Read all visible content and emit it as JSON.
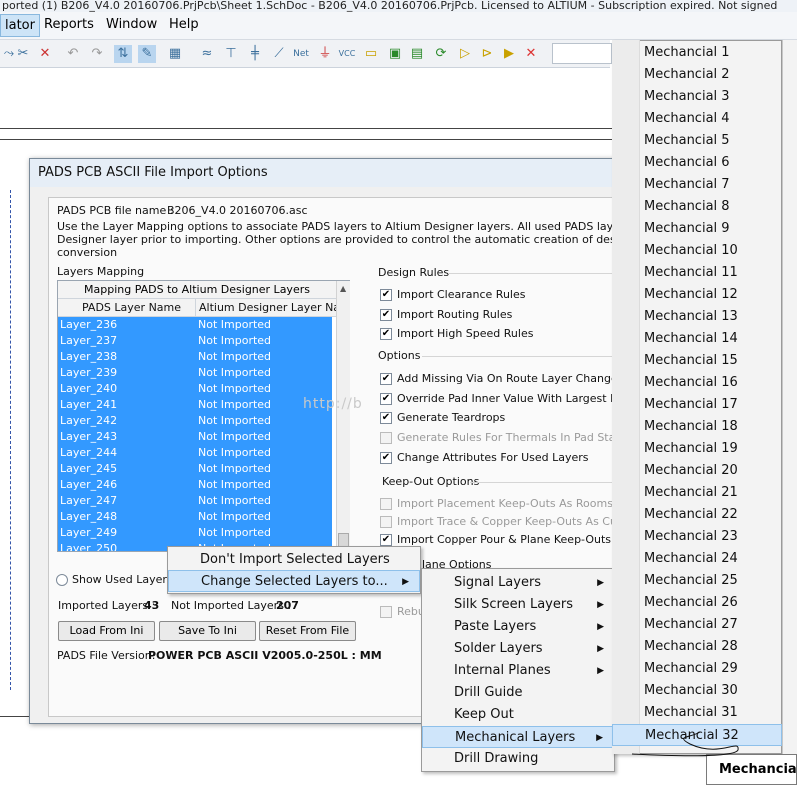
{
  "app": {
    "title": "ported (1) B206_V4.0 20160706.PrjPcb\\Sheet 1.SchDoc - B206_V4.0 20160706.PrjPcb. Licensed to ALTIUM - Subscription expired. Not signed"
  },
  "menubar": {
    "items": [
      "lator",
      "Reports",
      "Window",
      "Help"
    ]
  },
  "dialog": {
    "title": "PADS PCB ASCII File Import Options",
    "file_label": "PADS PCB file name :",
    "file_name": "B206_V4.0 20160706.asc",
    "desc1": "Use the Layer Mapping options to associate PADS layers to Altium Designer layers. All used PADS layers must be map",
    "desc2": "Designer layer prior to importing. Other options are provided to control the automatic creation of design rules, missing v",
    "desc3": "conversion",
    "layers_mapping_label": "Layers Mapping",
    "mapping_header": "Mapping PADS to Altium Designer Layers",
    "col1": "PADS Layer Name",
    "col2": "Altium Designer Layer Na...",
    "rows": [
      {
        "pads": "Layer_236",
        "altium": "Not Imported"
      },
      {
        "pads": "Layer_237",
        "altium": "Not Imported"
      },
      {
        "pads": "Layer_238",
        "altium": "Not Imported"
      },
      {
        "pads": "Layer_239",
        "altium": "Not Imported"
      },
      {
        "pads": "Layer_240",
        "altium": "Not Imported"
      },
      {
        "pads": "Layer_241",
        "altium": "Not Imported"
      },
      {
        "pads": "Layer_242",
        "altium": "Not Imported"
      },
      {
        "pads": "Layer_243",
        "altium": "Not Imported"
      },
      {
        "pads": "Layer_244",
        "altium": "Not Imported"
      },
      {
        "pads": "Layer_245",
        "altium": "Not Imported"
      },
      {
        "pads": "Layer_246",
        "altium": "Not Imported"
      },
      {
        "pads": "Layer_247",
        "altium": "Not Imported"
      },
      {
        "pads": "Layer_248",
        "altium": "Not Imported"
      },
      {
        "pads": "Layer_249",
        "altium": "Not Imported"
      },
      {
        "pads": "Layer_250",
        "altium": "Not Imported"
      }
    ],
    "show_used_layers": "Show Used Layers O",
    "imported_label": "Imported Layers :",
    "imported_count": "43",
    "not_imported_label": "Not Imported Layers :",
    "not_imported_count": "207",
    "load_button": "Load From Ini",
    "save_button": "Save To Ini",
    "reset_button": "Reset From File",
    "version_label": "PADS File Version:",
    "version_value": "POWER PCB ASCII V2005.0-250L : MM",
    "design_rules_label": "Design Rules",
    "rules": [
      "Import Clearance Rules",
      "Import Routing Rules",
      "Import High Speed Rules"
    ],
    "options_label": "Options",
    "options": [
      {
        "label": "Add Missing Via On Route Layer Change",
        "checked": true,
        "enabled": true
      },
      {
        "label": "Override Pad Inner Value With Largest Found",
        "checked": true,
        "enabled": true
      },
      {
        "label": "Generate Teardrops",
        "checked": true,
        "enabled": true
      },
      {
        "label": "Generate Rules For Thermals In Pad Stacks",
        "checked": false,
        "enabled": false
      },
      {
        "label": "Change Attributes For Used Layers",
        "checked": true,
        "enabled": true
      }
    ],
    "keepout_label": "Keep-Out Options",
    "keepouts": [
      {
        "label": "Import Placement Keep-Outs As Rooms",
        "checked": false,
        "enabled": false
      },
      {
        "label": "Import Trace & Copper Keep-Outs As Cut-Out",
        "checked": false,
        "enabled": false
      },
      {
        "label": "Import Copper Pour & Plane Keep-Outs As Cu",
        "checked": true,
        "enabled": true
      }
    ],
    "plane_options_label": "lane Options",
    "rebu_label": "Rebu"
  },
  "context_menu": {
    "items": [
      "Don't Import Selected Layers",
      "Change Selected Layers to..."
    ]
  },
  "layer_types_menu": {
    "items": [
      "Signal Layers",
      "Silk Screen Layers",
      "Paste Layers",
      "Solder Layers",
      "Internal Planes",
      "Drill Guide",
      "Keep Out",
      "Mechanical Layers",
      "Drill Drawing"
    ]
  },
  "mechanical_menu": {
    "items": [
      "Mechancial 1",
      "Mechancial 2",
      "Mechancial 3",
      "Mechancial 4",
      "Mechancial 5",
      "Mechancial 6",
      "Mechancial 7",
      "Mechancial 8",
      "Mechancial 9",
      "Mechancial 10",
      "Mechancial 11",
      "Mechancial 12",
      "Mechancial 13",
      "Mechancial 14",
      "Mechancial 15",
      "Mechancial 16",
      "Mechancial 17",
      "Mechancial 18",
      "Mechancial 19",
      "Mechancial 20",
      "Mechancial 21",
      "Mechancial 22",
      "Mechancial 23",
      "Mechancial 24",
      "Mechancial 25",
      "Mechancial 26",
      "Mechancial 27",
      "Mechancial 28",
      "Mechancial 29",
      "Mechancial 30",
      "Mechancial 31",
      "Mechancial 32"
    ]
  },
  "tooltip": {
    "text": "Mechancial"
  },
  "watermark": {
    "text": "http://b"
  },
  "colors": {
    "selection": "#3399ff",
    "highlight": "#cfe5fa"
  }
}
